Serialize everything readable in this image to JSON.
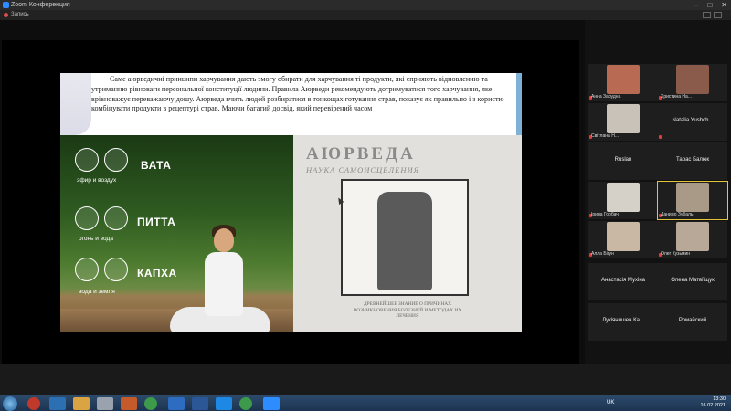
{
  "window": {
    "title": "Zoom Конференция"
  },
  "toolbar": {
    "label": "Запись"
  },
  "slide": {
    "paragraph": "Саме аюрведичні принципи харчування дають змогу обирати для харчування ті продукти, які сприяють відновленню та утриманню рівноваги персональної конституції людини. Правила Аюрведи рекомендують дотримуватися того харчування, яке врівноважує переважаючу дошу. Аюрведа вчить людей розбиратися в тонкощах готування страв, показує як правильно і з користю комбінувати продукти в рецептурі страв. Маючи багатий досвід, який перевірений часом",
    "doshas": [
      {
        "name": "ВАТА",
        "sub": "эфир и воздух"
      },
      {
        "name": "ПИТТА",
        "sub": "огонь и вода"
      },
      {
        "name": "КАПХА",
        "sub": "вода и земля"
      }
    ],
    "book": {
      "title": "АЮРВЕДА",
      "subtitle": "НАУКА САМОИСЦЕЛЕНИЯ",
      "note": "ДРЕВНЕЙШЕЕ ЗНАНИЕ О ПРИЧИНАХ ВОЗНИКНОВЕНИЯ БОЛЕЗНЕЙ И МЕТОДАХ ИХ ЛЕЧЕНИЯ"
    }
  },
  "participants": [
    {
      "name": "Анна Зарудна",
      "photo": true,
      "color": "#b86a52"
    },
    {
      "name": "Христина На...",
      "photo": true,
      "color": "#8a5a4a"
    },
    {
      "name": "Світлана Н...",
      "photo": true,
      "color": "#c9c2b8"
    },
    {
      "name": "Natalia Yushch...",
      "photo": false
    },
    {
      "name": "Ruslan",
      "photo": false
    },
    {
      "name": "Тарас Балюк",
      "photo": false
    },
    {
      "name": "Ірина Горбач",
      "photo": true,
      "color": "#d5d0c8"
    },
    {
      "name": "Данило Зубаль",
      "photo": true,
      "color": "#a89a86",
      "active": true
    },
    {
      "name": "Алла Бігун",
      "photo": true,
      "color": "#c8b8a4"
    },
    {
      "name": "Олег Кузьмин",
      "photo": true,
      "color": "#b8a898"
    },
    {
      "name": "Анастасія Мухіна",
      "photo": false
    },
    {
      "name": "Олена Матвіїщук",
      "photo": false
    },
    {
      "name": "Лукіянишен Ка...",
      "photo": false
    },
    {
      "name": "Ромайский",
      "photo": false
    }
  ],
  "tray": {
    "lang": "UK",
    "time": "13:30",
    "date": "16.02.2021"
  }
}
